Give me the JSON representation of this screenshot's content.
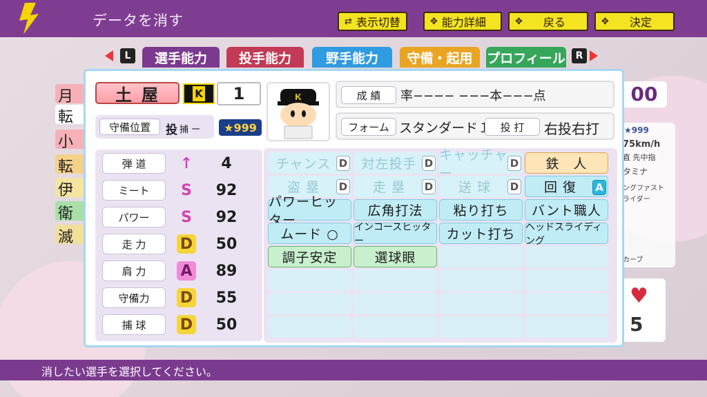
{
  "header": {
    "title": "データを消す",
    "buttons": [
      {
        "label": "表示切替",
        "icon": "toggle-icon"
      },
      {
        "label": "能力詳細",
        "icon": "dpad-icon"
      },
      {
        "label": "戻る",
        "icon": "dpad-icon"
      },
      {
        "label": "決定",
        "icon": "dpad-icon"
      }
    ]
  },
  "tabs": [
    {
      "label": "選手能力",
      "color": "#7b3a8f"
    },
    {
      "label": "投手能力",
      "color": "#c23a55"
    },
    {
      "label": "野手能力",
      "color": "#2f9be0"
    },
    {
      "label": "守備・起用",
      "color": "#e9a522"
    },
    {
      "label": "プロフィール",
      "color": "#36a65b"
    }
  ],
  "nav": {
    "left": "L",
    "right": "R"
  },
  "player": {
    "name": "土屋",
    "team_logo": "K",
    "number": "1",
    "position_label": "守備位置",
    "position_main": "投",
    "position_sub": "捕 ー",
    "star_rating": "999",
    "record_label": "成 績",
    "record_value": "率−−−− −−−本−−−点",
    "form_label": "フォーム",
    "form_value": "スタンダード１",
    "throwbat_label": "投 打",
    "throwbat_value": "右投右打"
  },
  "stats": [
    {
      "label": "弾 道",
      "grade": "↑",
      "value": "4",
      "color": "#d35fc8"
    },
    {
      "label": "ミート",
      "grade": "S",
      "value": "92",
      "color": "#d343b0"
    },
    {
      "label": "パワー",
      "grade": "S",
      "value": "92",
      "color": "#d343b0"
    },
    {
      "label": "走 力",
      "grade": "D",
      "value": "50",
      "color": "#f2d23a"
    },
    {
      "label": "肩 力",
      "grade": "A",
      "value": "89",
      "color": "#f08bd8"
    },
    {
      "label": "守備力",
      "grade": "D",
      "value": "55",
      "color": "#f2d23a"
    },
    {
      "label": "捕 球",
      "grade": "D",
      "value": "50",
      "color": "#f2d23a"
    }
  ],
  "abilities": [
    [
      {
        "label": "チャンス",
        "grade": "D",
        "style": "fade"
      },
      {
        "label": "対左投手",
        "grade": "D",
        "style": "fade"
      },
      {
        "label": "キャッチャー",
        "grade": "D",
        "style": "fade"
      },
      {
        "label": "鉄　人",
        "grade": "",
        "style": "gold"
      }
    ],
    [
      {
        "label": "盗 塁",
        "grade": "D",
        "style": "fade"
      },
      {
        "label": "走 塁",
        "grade": "D",
        "style": "fade"
      },
      {
        "label": "送 球",
        "grade": "D",
        "style": "fade"
      },
      {
        "label": "回 復",
        "grade": "A",
        "style": "blue"
      }
    ],
    [
      {
        "label": "パワーヒッター",
        "grade": "",
        "style": "blue"
      },
      {
        "label": "広角打法",
        "grade": "",
        "style": "blue"
      },
      {
        "label": "粘り打ち",
        "grade": "",
        "style": "blue"
      },
      {
        "label": "バント職人",
        "grade": "",
        "style": "blue"
      }
    ],
    [
      {
        "label": "ムード ○",
        "grade": "",
        "style": "blue"
      },
      {
        "label": "インコースヒッター",
        "grade": "",
        "style": "blue"
      },
      {
        "label": "カット打ち",
        "grade": "",
        "style": "blue"
      },
      {
        "label": "ヘッドスライディング",
        "grade": "",
        "style": "blue"
      }
    ],
    [
      {
        "label": "調子安定",
        "grade": "",
        "style": "green"
      },
      {
        "label": "選球眼",
        "grade": "",
        "style": "green"
      },
      {
        "label": "",
        "grade": "",
        "style": "empty"
      },
      {
        "label": "",
        "grade": "",
        "style": "empty"
      }
    ],
    [
      {
        "label": "",
        "grade": "",
        "style": "empty"
      },
      {
        "label": "",
        "grade": "",
        "style": "empty"
      },
      {
        "label": "",
        "grade": "",
        "style": "empty"
      },
      {
        "label": "",
        "grade": "",
        "style": "empty"
      }
    ],
    [
      {
        "label": "",
        "grade": "",
        "style": "empty"
      },
      {
        "label": "",
        "grade": "",
        "style": "empty"
      },
      {
        "label": "",
        "grade": "",
        "style": "empty"
      },
      {
        "label": "",
        "grade": "",
        "style": "empty"
      }
    ],
    [
      {
        "label": "",
        "grade": "",
        "style": "empty"
      },
      {
        "label": "",
        "grade": "",
        "style": "empty"
      },
      {
        "label": "",
        "grade": "",
        "style": "empty"
      },
      {
        "label": "",
        "grade": "",
        "style": "empty"
      }
    ]
  ],
  "background": {
    "left_chars": [
      "月",
      "転",
      "小",
      "転",
      "伊",
      "衛",
      "滅"
    ],
    "right_partial": {
      "score": "00",
      "stars": "999",
      "speed": "75km/h",
      "pitch": "直 先中指",
      "stamina": "タミナ",
      "skill1": "ングファスト",
      "skill2": "ライダー",
      "curve": "カーブ",
      "hearts": "5"
    }
  },
  "footer": {
    "message": "消したい選手を選択してください。"
  }
}
